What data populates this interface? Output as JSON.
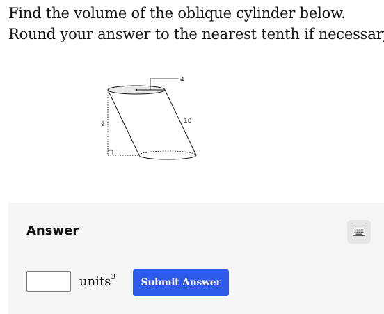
{
  "question": {
    "line1": "Find the volume of the oblique cylinder below.",
    "line2": "Round your answer to the nearest tenth if necessary."
  },
  "figure": {
    "radius_label": "4",
    "slant_label": "10",
    "height_label": "9"
  },
  "answer": {
    "heading": "Answer",
    "input_value": "",
    "units_text": "units",
    "units_exponent": "3",
    "submit_label": "Submit Answer",
    "keyboard_icon": "keyboard-icon"
  },
  "colors": {
    "submit_button": "#2f5bea",
    "panel_background": "#f6f6f6"
  }
}
